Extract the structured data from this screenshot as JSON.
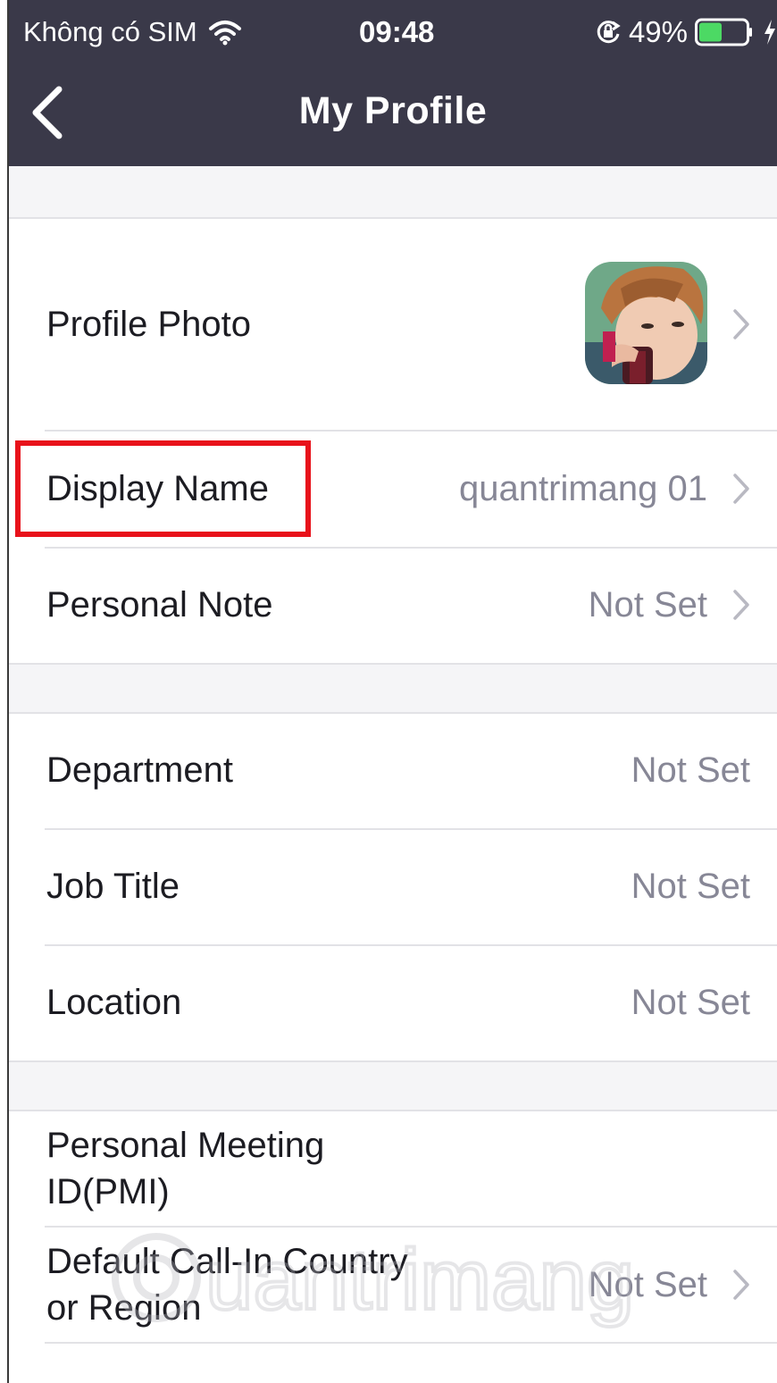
{
  "status_bar": {
    "carrier": "Không có SIM",
    "time": "09:48",
    "battery_percent": "49%",
    "battery_level": 0.49
  },
  "nav": {
    "title": "My Profile"
  },
  "rows": {
    "profile_photo": {
      "label": "Profile Photo"
    },
    "display_name": {
      "label": "Display Name",
      "value": "quantrimang 01"
    },
    "personal_note": {
      "label": "Personal Note",
      "value": "Not Set"
    },
    "department": {
      "label": "Department",
      "value": "Not Set"
    },
    "job_title": {
      "label": "Job Title",
      "value": "Not Set"
    },
    "location": {
      "label": "Location",
      "value": "Not Set"
    },
    "pmi": {
      "label_line1": "Personal Meeting",
      "label_line2": "ID(PMI)"
    },
    "call_in": {
      "label_line1": "Default Call-In Country",
      "label_line2": "or Region",
      "value": "Not Set"
    }
  },
  "watermark": {
    "text": "uantrimang"
  },
  "colors": {
    "header_bg": "#3a3949",
    "highlight": "#e8121b",
    "value_text": "#878796",
    "battery_fill": "#4cd964"
  },
  "icons": [
    "back-chevron-icon",
    "wifi-icon",
    "orientation-lock-icon",
    "battery-icon",
    "charging-bolt-icon",
    "chevron-right-icon"
  ]
}
